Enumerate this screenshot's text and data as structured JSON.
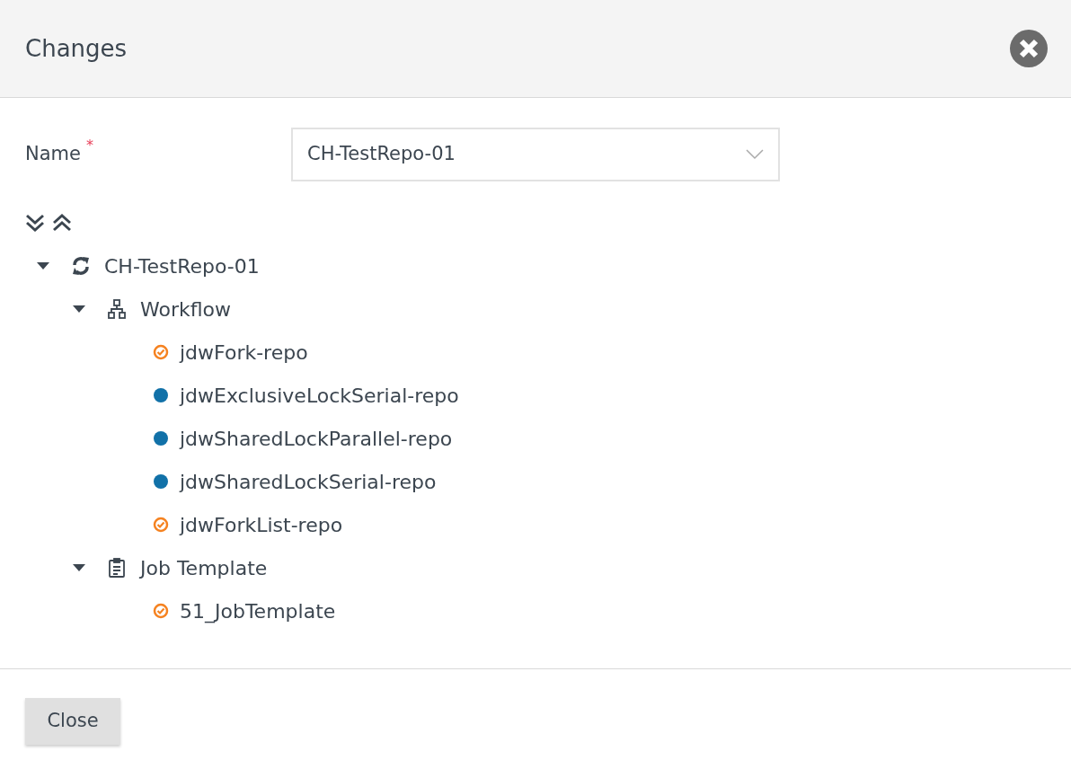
{
  "dialog": {
    "title": "Changes"
  },
  "form": {
    "label": "Name",
    "required_mark": "*",
    "value": "CH-TestRepo-01"
  },
  "tree": [
    {
      "label": "CH-TestRepo-01",
      "kind": "repo",
      "expanded": true,
      "children": [
        {
          "label": "Workflow",
          "kind": "workflow",
          "expanded": true,
          "children": [
            {
              "label": "jdwFork-repo",
              "kind": "check",
              "color": "#f58220"
            },
            {
              "label": "jdwExclusiveLockSerial-repo",
              "kind": "dot",
              "color": "#1171a8"
            },
            {
              "label": "jdwSharedLockParallel-repo",
              "kind": "dot",
              "color": "#1171a8"
            },
            {
              "label": "jdwSharedLockSerial-repo",
              "kind": "dot",
              "color": "#1171a8"
            },
            {
              "label": "jdwForkList-repo",
              "kind": "check",
              "color": "#f58220"
            }
          ]
        },
        {
          "label": "Job Template",
          "kind": "jobtemplate",
          "expanded": true,
          "children": [
            {
              "label": "51_JobTemplate",
              "kind": "check",
              "color": "#f58220"
            }
          ]
        }
      ]
    }
  ],
  "buttons": {
    "close": "Close"
  }
}
